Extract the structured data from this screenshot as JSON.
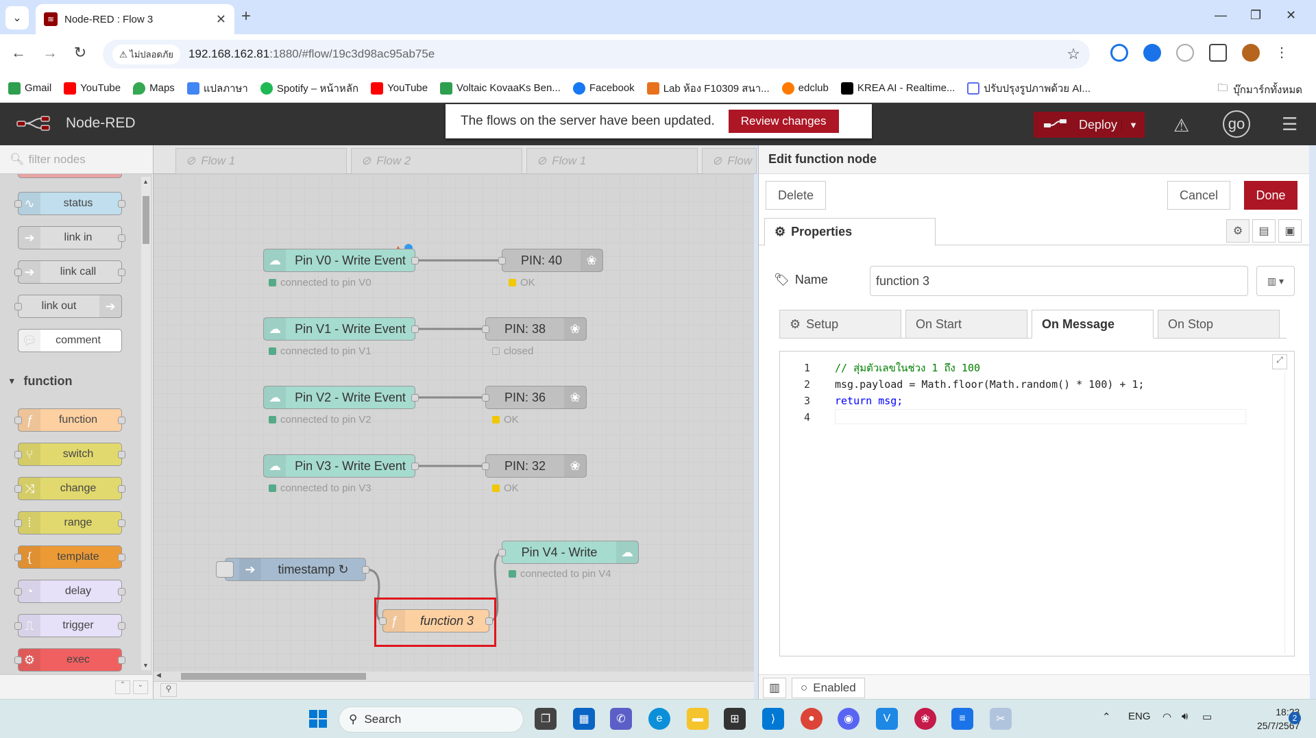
{
  "browser": {
    "tab_title": "Node-RED : Flow 3",
    "security_label": "ไม่ปลอดภัย",
    "url_host": "192.168.162.81",
    "url_rest": ":1880/#flow/19c3d98ac95ab75e",
    "bookmarks": [
      "Gmail",
      "YouTube",
      "Maps",
      "แปลภาษา",
      "Spotify – หน้าหลัก",
      "YouTube",
      "Voltaic KovaaKs Ben...",
      "Facebook",
      "Lab ห้อง F10309 สนา...",
      "edclub",
      "KREA AI - Realtime...",
      "ปรับปรุงรูปภาพด้วย AI..."
    ],
    "all_bookmarks": "บุ๊กมาร์กทั้งหมด"
  },
  "header": {
    "app_name": "Node-RED",
    "notification_text": "The flows on the server have been updated.",
    "review_label": "Review changes",
    "deploy_label": "Deploy",
    "user_initials": "go"
  },
  "palette": {
    "filter_placeholder": "filter nodes",
    "common_nodes": [
      {
        "label": "status",
        "color": "#c0deed"
      },
      {
        "label": "link in",
        "color": "#dddddd"
      },
      {
        "label": "link call",
        "color": "#dddddd"
      },
      {
        "label": "link out",
        "color": "#dddddd"
      },
      {
        "label": "comment",
        "color": "#ffffff"
      }
    ],
    "function_category": "function",
    "function_nodes": [
      {
        "label": "function",
        "color": "#fdd0a2"
      },
      {
        "label": "switch",
        "color": "#e2d96e"
      },
      {
        "label": "change",
        "color": "#e2d96e"
      },
      {
        "label": "range",
        "color": "#e2d96e"
      },
      {
        "label": "template",
        "color": "#ec9a36"
      },
      {
        "label": "delay",
        "color": "#e6e0f8"
      },
      {
        "label": "trigger",
        "color": "#e6e0f8"
      },
      {
        "label": "exec",
        "color": "#f06060"
      }
    ]
  },
  "workspace": {
    "tabs": [
      "Flow 1",
      "Flow 2",
      "Flow 1",
      "Flow"
    ],
    "nodes": {
      "v0": {
        "label": "Pin V0 - Write Event",
        "status": "connected to pin V0"
      },
      "pin40": {
        "label": "PIN: 40",
        "status": "OK"
      },
      "v1": {
        "label": "Pin V1 - Write Event",
        "status": "connected to pin V1"
      },
      "pin38": {
        "label": "PIN: 38",
        "status": "closed"
      },
      "v2": {
        "label": "Pin V2 - Write Event",
        "status": "connected to pin V2"
      },
      "pin36": {
        "label": "PIN: 36",
        "status": "OK"
      },
      "v3": {
        "label": "Pin V3 - Write Event",
        "status": "connected to pin V3"
      },
      "pin32": {
        "label": "PIN: 32",
        "status": "OK"
      },
      "v4": {
        "label": "Pin V4 - Write",
        "status": "connected to pin V4"
      },
      "timestamp": {
        "label": "timestamp ↻"
      },
      "function3": {
        "label": "function 3"
      }
    },
    "colors": {
      "blynk": "#a6dbcf",
      "rpi": "#c0c0c0",
      "inject": "#a6bbcf",
      "function": "#fdd0a2",
      "highlight": "#e0161d"
    }
  },
  "editor": {
    "title": "Edit function node",
    "delete_label": "Delete",
    "cancel_label": "Cancel",
    "done_label": "Done",
    "properties_tab": "Properties",
    "name_label": "Name",
    "name_value": "function 3",
    "subtabs": [
      "Setup",
      "On Start",
      "On Message",
      "On Stop"
    ],
    "code_lines": [
      "// สุ่มตัวเลขในช่วง 1 ถึง 100",
      "msg.payload = Math.floor(Math.random() * 100) + 1;",
      "return msg;",
      ""
    ],
    "enabled_label": "Enabled"
  },
  "taskbar": {
    "search_label": "Search",
    "lang": "ENG",
    "time": "18:23",
    "date": "25/7/2567",
    "notif_count": "2"
  }
}
